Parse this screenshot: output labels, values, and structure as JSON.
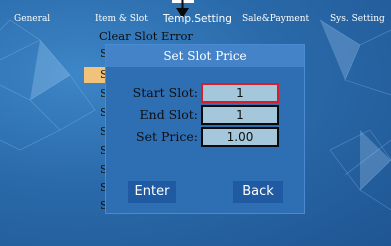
{
  "tabs": [
    "General",
    "Item & Slot",
    "Temp.Setting",
    "Sale&Payment",
    "Sys. Setting"
  ],
  "menu": {
    "first_item": "Clear Slot Error",
    "partial_items": [
      "S",
      "S",
      "S",
      "S",
      "S",
      "S",
      "S",
      "S",
      "S"
    ]
  },
  "dialog": {
    "title": "Set Slot Price",
    "start_label": "Start Slot:",
    "start_value": "1",
    "end_label": "End Slot:",
    "end_value": "1",
    "price_label": "Set Price:",
    "price_value": "1.00",
    "enter_label": "Enter",
    "back_label": "Back"
  },
  "colors": {
    "background": "#2a6aaa",
    "dialog": "#2e6fb4",
    "title_bar": "#4583c8",
    "field": "#a5c7dc",
    "active_border": "#d71e2a",
    "button": "#1f5aa2",
    "menu_highlight": "#f0c27a"
  },
  "icons": {
    "top": "down-arrow-icon"
  }
}
